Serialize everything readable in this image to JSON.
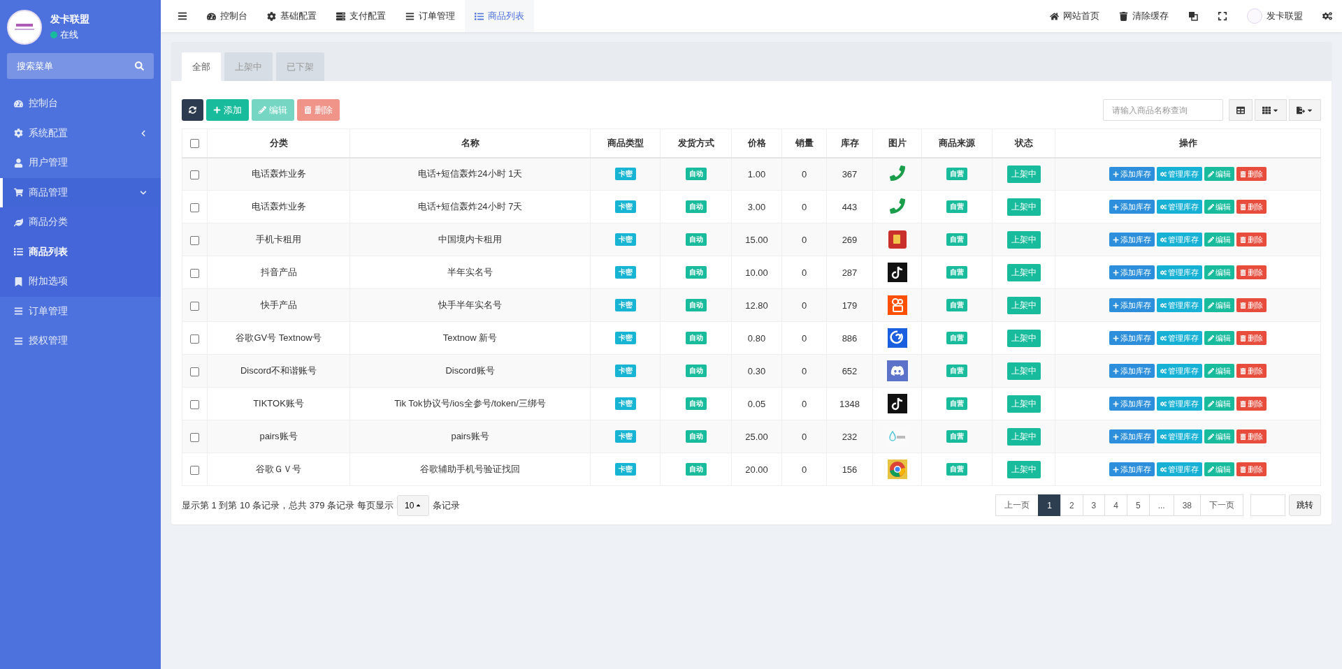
{
  "sidebar": {
    "title": "发卡联盟",
    "status": "在线",
    "online": true,
    "search": {
      "placeholder": "搜索菜单"
    },
    "items": [
      {
        "label": "控制台",
        "selected": false
      },
      {
        "label": "系统配置",
        "selected": false,
        "expanded": false
      },
      {
        "label": "用户管理",
        "selected": false
      },
      {
        "label": "商品管理",
        "selected": false,
        "expanded": true,
        "children": [
          {
            "label": "商品分类",
            "selected": false
          },
          {
            "label": "商品列表",
            "selected": true
          },
          {
            "label": "附加选项",
            "selected": false
          }
        ]
      },
      {
        "label": "订单管理",
        "selected": false
      },
      {
        "label": "授权管理",
        "selected": false
      }
    ]
  },
  "topbar": {
    "tabs": [
      {
        "label": "控制台",
        "selected": false
      },
      {
        "label": "基础配置",
        "selected": false
      },
      {
        "label": "支付配置",
        "selected": false
      },
      {
        "label": "订单管理",
        "selected": false
      },
      {
        "label": "商品列表",
        "selected": true
      }
    ],
    "links": [
      "网站首页",
      "清除缓存"
    ],
    "user": "发卡联盟"
  },
  "filter_tabs": [
    {
      "label": "全部",
      "selected": true
    },
    {
      "label": "上架中",
      "selected": false
    },
    {
      "label": "已下架",
      "selected": false
    }
  ],
  "toolbar": {
    "buttons": [
      {
        "kind": "refresh",
        "disabled": false
      },
      {
        "kind": "add",
        "label": "添加",
        "disabled": false
      },
      {
        "kind": "edit",
        "label": "编辑",
        "disabled": true
      },
      {
        "kind": "delete",
        "label": "删除",
        "disabled": true
      }
    ],
    "search": {
      "placeholder": "请输入商品名称查询"
    }
  },
  "table": {
    "select_all_checked": false,
    "columns": [
      "分类",
      "名称",
      "商品类型",
      "发货方式",
      "价格",
      "销量",
      "库存",
      "图片",
      "商品来源",
      "状态",
      "操作"
    ],
    "rows": [
      {
        "checked": false,
        "category": "电话轰炸业务",
        "name": "电话+短信轰炸24小时 1天",
        "type": "卡密",
        "delivery": "自动",
        "price": "1.00",
        "sales": "0",
        "stock": "367",
        "source": "自营",
        "status": "上架中",
        "actions": [
          "添加库存",
          "管理库存",
          "编辑",
          "删除"
        ]
      },
      {
        "checked": false,
        "category": "电话轰炸业务",
        "name": "电话+短信轰炸24小时 7天",
        "type": "卡密",
        "delivery": "自动",
        "price": "3.00",
        "sales": "0",
        "stock": "443",
        "source": "自营",
        "status": "上架中",
        "actions": [
          "添加库存",
          "管理库存",
          "编辑",
          "删除"
        ]
      },
      {
        "checked": false,
        "category": "手机卡租用",
        "name": "中国境内卡租用",
        "type": "卡密",
        "delivery": "自动",
        "price": "15.00",
        "sales": "0",
        "stock": "269",
        "source": "自营",
        "status": "上架中",
        "actions": [
          "添加库存",
          "管理库存",
          "编辑",
          "删除"
        ]
      },
      {
        "checked": false,
        "category": "抖音产品",
        "name": "半年实名号",
        "type": "卡密",
        "delivery": "自动",
        "price": "10.00",
        "sales": "0",
        "stock": "287",
        "source": "自营",
        "status": "上架中",
        "actions": [
          "添加库存",
          "管理库存",
          "编辑",
          "删除"
        ]
      },
      {
        "checked": false,
        "category": "快手产品",
        "name": "快手半年实名号",
        "type": "卡密",
        "delivery": "自动",
        "price": "12.80",
        "sales": "0",
        "stock": "179",
        "source": "自营",
        "status": "上架中",
        "actions": [
          "添加库存",
          "管理库存",
          "编辑",
          "删除"
        ]
      },
      {
        "checked": false,
        "category": "谷歌GV号 Textnow号",
        "name": "Textnow 新号",
        "type": "卡密",
        "delivery": "自动",
        "price": "0.80",
        "sales": "0",
        "stock": "886",
        "source": "自营",
        "status": "上架中",
        "actions": [
          "添加库存",
          "管理库存",
          "编辑",
          "删除"
        ]
      },
      {
        "checked": false,
        "category": "Discord不和谐账号",
        "name": "Discord账号",
        "type": "卡密",
        "delivery": "自动",
        "price": "0.30",
        "sales": "0",
        "stock": "652",
        "source": "自营",
        "status": "上架中",
        "actions": [
          "添加库存",
          "管理库存",
          "编辑",
          "删除"
        ]
      },
      {
        "checked": false,
        "category": "TIKTOK账号",
        "name": "Tik Tok协议号/ios全参号/token/三绑号",
        "type": "卡密",
        "delivery": "自动",
        "price": "0.05",
        "sales": "0",
        "stock": "1348",
        "source": "自营",
        "status": "上架中",
        "actions": [
          "添加库存",
          "管理库存",
          "编辑",
          "删除"
        ]
      },
      {
        "checked": false,
        "category": "pairs账号",
        "name": "pairs账号",
        "type": "卡密",
        "delivery": "自动",
        "price": "25.00",
        "sales": "0",
        "stock": "232",
        "source": "自营",
        "status": "上架中",
        "actions": [
          "添加库存",
          "管理库存",
          "编辑",
          "删除"
        ]
      },
      {
        "checked": false,
        "category": "谷歌ＧＶ号",
        "name": "谷歌辅助手机号验证找回",
        "type": "卡密",
        "delivery": "自动",
        "price": "20.00",
        "sales": "0",
        "stock": "156",
        "source": "自营",
        "status": "上架中",
        "actions": [
          "添加库存",
          "管理库存",
          "编辑",
          "删除"
        ]
      }
    ]
  },
  "pagination": {
    "info": "显示第 1 到第 10 条记录，总共 379 条记录",
    "per_page_label": "每页显示",
    "per_page": "10",
    "per_page_suffix": "条记录",
    "prev": "上一页",
    "next": "下一页",
    "pages": [
      {
        "label": "1",
        "selected": true
      },
      {
        "label": "2",
        "selected": false
      },
      {
        "label": "3",
        "selected": false
      },
      {
        "label": "4",
        "selected": false
      },
      {
        "label": "5",
        "selected": false
      },
      {
        "label": "...",
        "selected": false
      },
      {
        "label": "38",
        "selected": false
      }
    ],
    "jump": "跳转"
  }
}
